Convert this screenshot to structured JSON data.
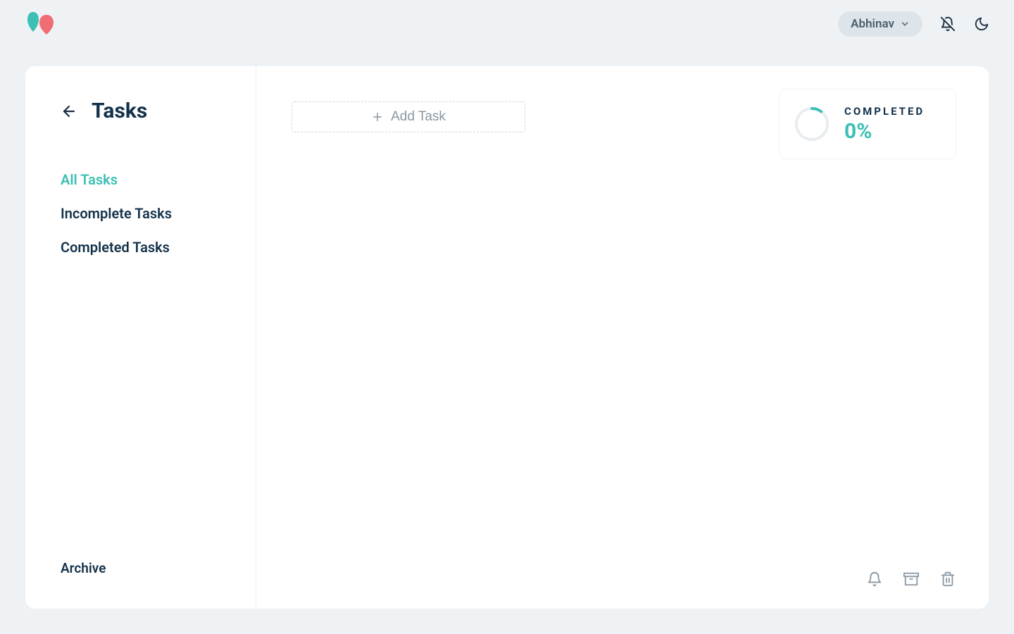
{
  "header": {
    "user_name": "Abhinav"
  },
  "sidebar": {
    "title": "Tasks",
    "nav": [
      {
        "label": "All Tasks",
        "active": true
      },
      {
        "label": "Incomplete Tasks",
        "active": false
      },
      {
        "label": "Completed Tasks",
        "active": false
      }
    ],
    "archive_label": "Archive"
  },
  "main": {
    "add_task_label": "Add Task"
  },
  "completed_widget": {
    "label": "COMPLETED",
    "value": "0%",
    "percent": 0
  },
  "colors": {
    "accent": "#3cbfb4",
    "text_dark": "#14324a",
    "muted": "#8a97a3"
  }
}
